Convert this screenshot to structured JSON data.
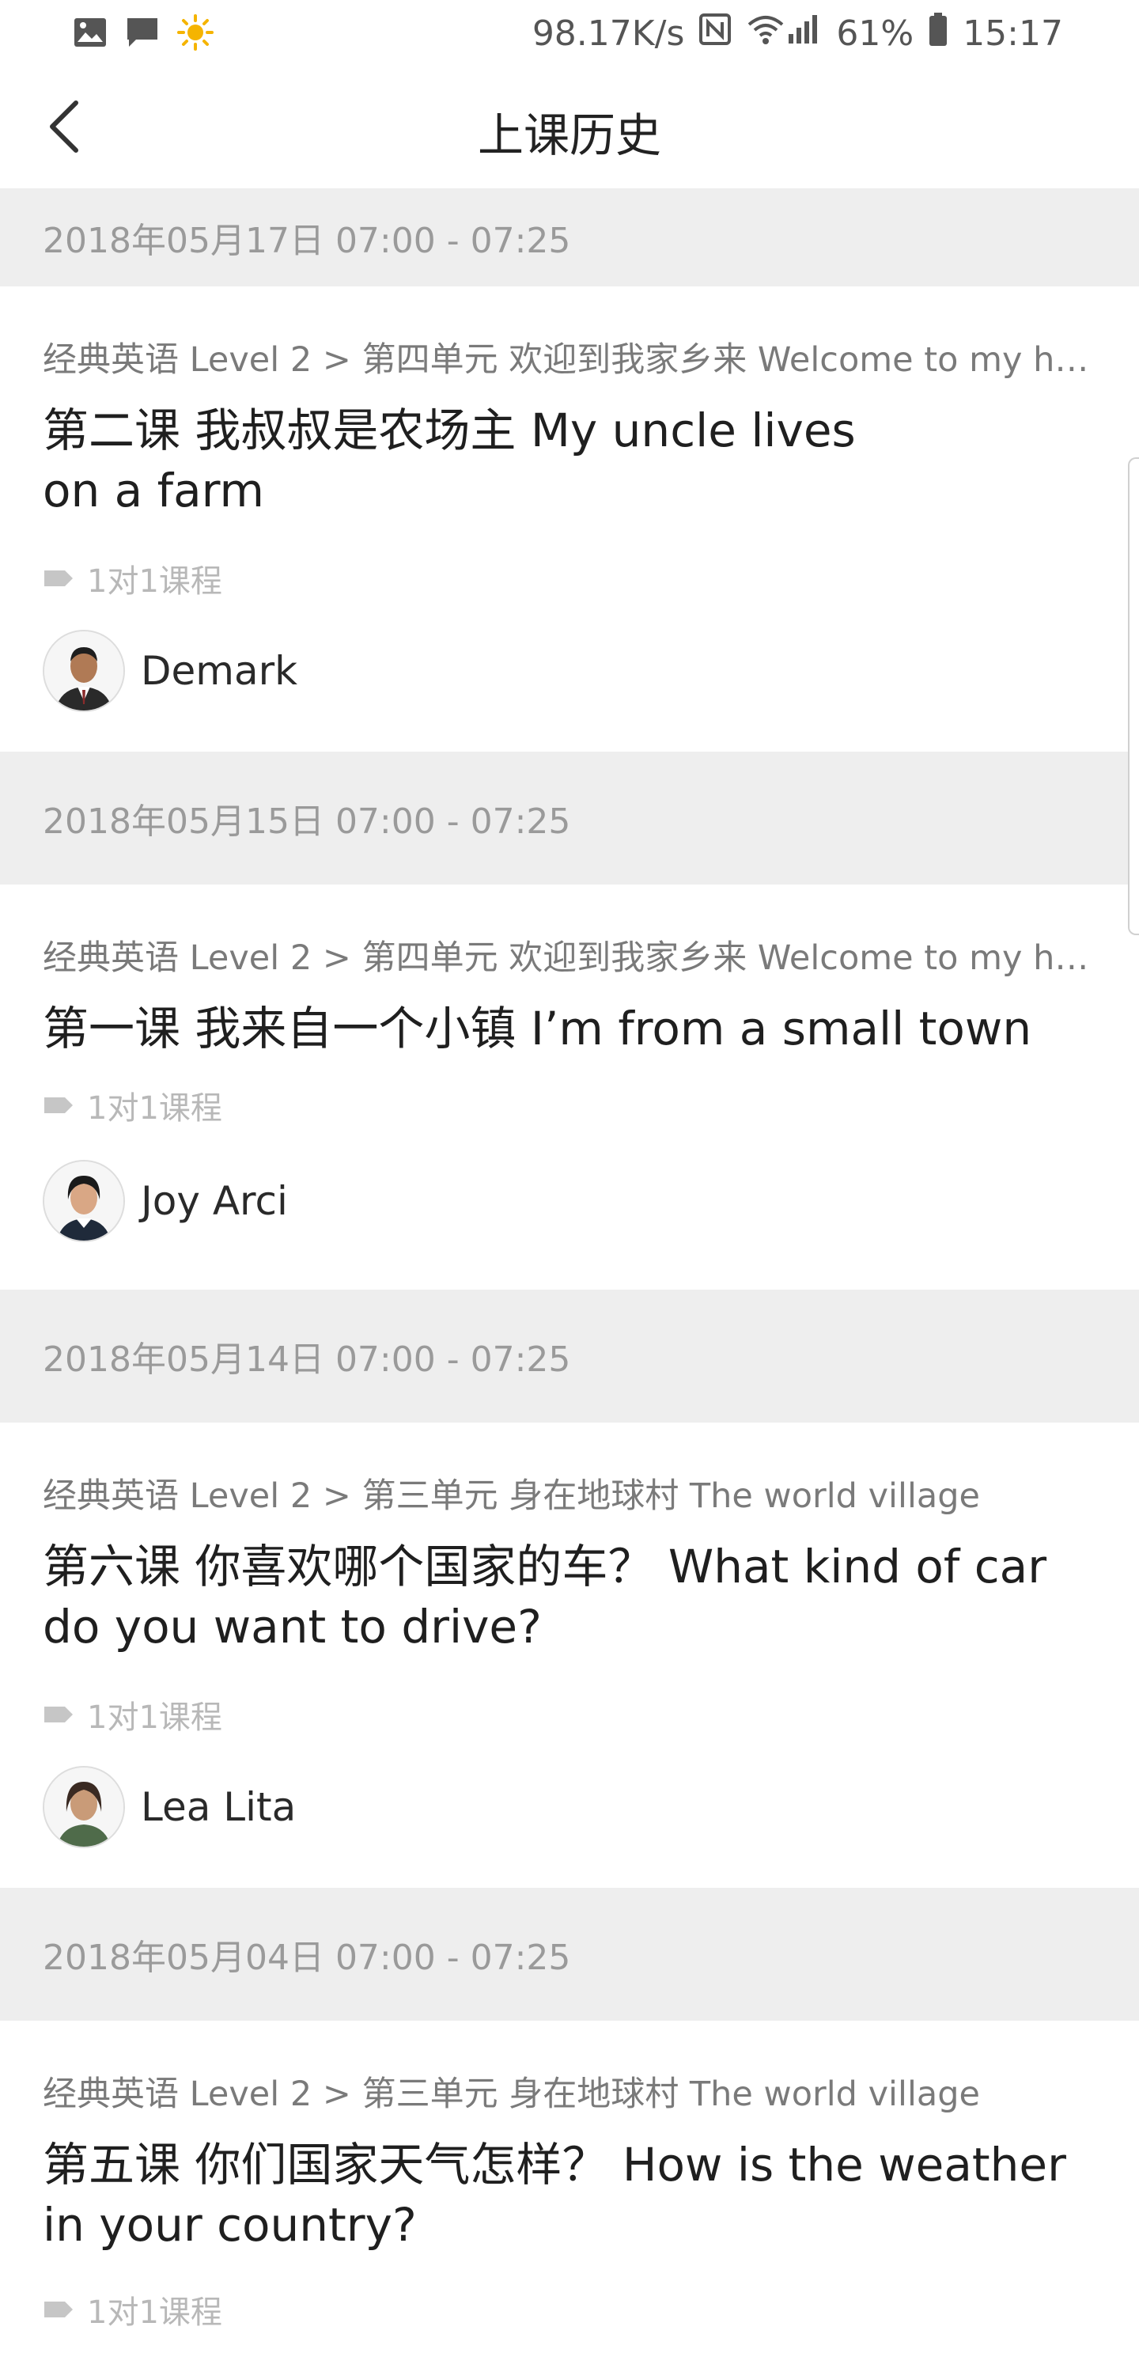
{
  "status_bar": {
    "net_speed": "98.17K/s",
    "battery": "61%",
    "time": "15:17",
    "icons": [
      "image-icon",
      "message-icon",
      "sun-icon",
      "nfc-icon",
      "wifi-icon",
      "signal-4g-icon",
      "battery-icon"
    ]
  },
  "app_bar": {
    "title": "上课历史",
    "back_icon": "chevron-left-icon"
  },
  "colors": {
    "divider_bg": "#eeeeee",
    "meta_gray": "#9a9a9a",
    "title_dark": "#1f1f1f"
  },
  "history": [
    {
      "date": "2018年05月17日 07:00 - 07:25",
      "course_path": "经典英语 Level 2 > 第四单元 欢迎到我家乡来 Welcome to my hometown",
      "title_line1": "第二课 我叔叔是农场主 My uncle lives",
      "title_line2": "on a farm",
      "tag": "1对1课程",
      "teacher": "Demark"
    },
    {
      "date": "2018年05月15日 07:00 - 07:25",
      "course_path": "经典英语 Level 2 > 第四单元 欢迎到我家乡来 Welcome to my hometown",
      "title_line1": "第一课 我来自一个小镇 I’m from a small town",
      "title_line2": "",
      "tag": "1对1课程",
      "teacher": "Joy Arci"
    },
    {
      "date": "2018年05月14日 07:00 - 07:25",
      "course_path": "经典英语 Level 2 > 第三单元 身在地球村 The world village",
      "title_line1": "第六课 你喜欢哪个国家的车？ What kind of car",
      "title_line2": "do you want to drive?",
      "tag": "1对1课程",
      "teacher": "Lea Lita"
    },
    {
      "date": "2018年05月04日 07:00 - 07:25",
      "course_path": "经典英语 Level 2 > 第三单元 身在地球村 The world village",
      "title_line1": "第五课 你们国家天气怎样？ How is the weather",
      "title_line2": "in your country?",
      "tag": "1对1课程",
      "teacher": ""
    }
  ]
}
